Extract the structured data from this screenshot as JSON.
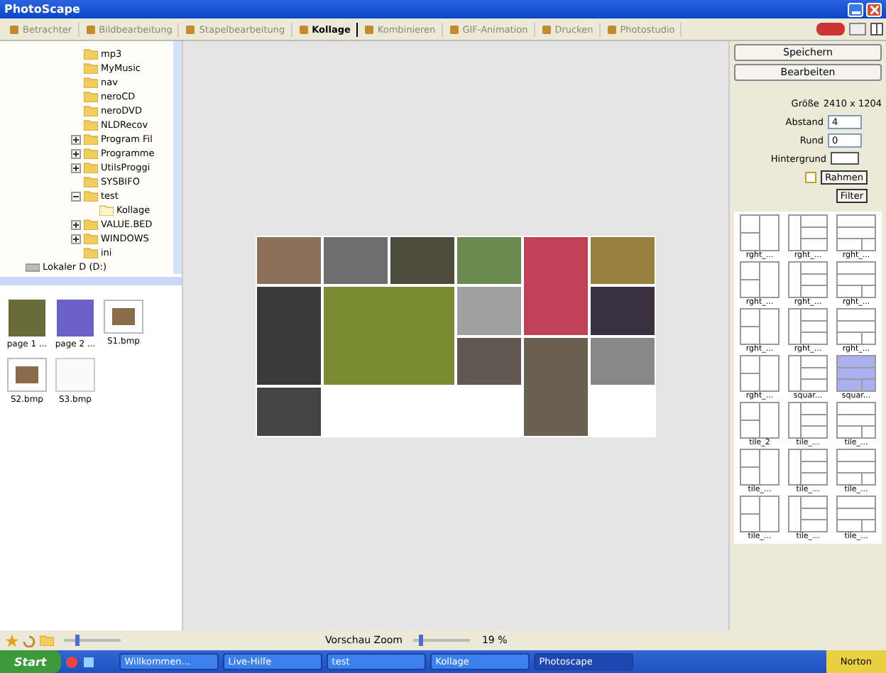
{
  "window": {
    "title": "PhotoScape"
  },
  "tabs": [
    {
      "label": "Betrachter",
      "selected": false
    },
    {
      "label": "Bildbearbeitung",
      "selected": false
    },
    {
      "label": "Stapelbearbeitung",
      "selected": false
    },
    {
      "label": "Kollage",
      "selected": true
    },
    {
      "label": "Kombinieren",
      "selected": false
    },
    {
      "label": "GIF-Animation",
      "selected": false
    },
    {
      "label": "Drucken",
      "selected": false
    },
    {
      "label": "Photostudio",
      "selected": false
    }
  ],
  "tree": {
    "folders": [
      {
        "label": "mp3",
        "expandable": false,
        "expanded": false
      },
      {
        "label": "MyMusic",
        "expandable": false,
        "expanded": false
      },
      {
        "label": "nav",
        "expandable": false,
        "expanded": false
      },
      {
        "label": "neroCD",
        "expandable": false,
        "expanded": false
      },
      {
        "label": "neroDVD",
        "expandable": false,
        "expanded": false
      },
      {
        "label": "NLDRecov",
        "expandable": false,
        "expanded": false
      },
      {
        "label": "Program Fil",
        "expandable": true,
        "expanded": false
      },
      {
        "label": "Programme",
        "expandable": true,
        "expanded": false
      },
      {
        "label": "UtilsProggi",
        "expandable": true,
        "expanded": false
      },
      {
        "label": "SYSBIFO",
        "expandable": false,
        "expanded": false
      },
      {
        "label": "test",
        "expandable": true,
        "expanded": true,
        "children": [
          {
            "label": "Kollage"
          }
        ]
      },
      {
        "label": "VALUE.BED",
        "expandable": true,
        "expanded": false
      },
      {
        "label": "WINDOWS",
        "expandable": true,
        "expanded": false
      },
      {
        "label": "ini",
        "expandable": false,
        "expanded": false
      }
    ],
    "drives": [
      {
        "label": "Lokaler D (D:)"
      }
    ]
  },
  "thumbnails": [
    {
      "label": "page 1 ...",
      "kind": "photo"
    },
    {
      "label": "page 2 ...",
      "kind": "photo"
    },
    {
      "label": "S1.bmp",
      "kind": "layout"
    },
    {
      "label": "S2.bmp",
      "kind": "layout"
    },
    {
      "label": "S3.bmp",
      "kind": "blank"
    }
  ],
  "panel": {
    "buttons": [
      "Speichern",
      "Bearbeiten"
    ],
    "size_label": "Größe",
    "size_value": "2410 x 1204",
    "spacing_label": "Abstand",
    "spacing_value": "4",
    "round_label": "Rund",
    "round_value": "0",
    "background_label": "Hintergrund",
    "frame": {
      "label": "Rahmen",
      "checked": false
    },
    "filter_button": "Filter"
  },
  "templates": [
    {
      "label": "rght_...",
      "selected": false
    },
    {
      "label": "rght_...",
      "selected": false
    },
    {
      "label": "rght_...",
      "selected": false
    },
    {
      "label": "rght_...",
      "selected": false
    },
    {
      "label": "rght_...",
      "selected": false
    },
    {
      "label": "rght_...",
      "selected": false
    },
    {
      "label": "rght_...",
      "selected": false
    },
    {
      "label": "rght_...",
      "selected": false
    },
    {
      "label": "rght_...",
      "selected": false
    },
    {
      "label": "rght_...",
      "selected": false
    },
    {
      "label": "squar...",
      "selected": false
    },
    {
      "label": "squar...",
      "selected": true
    },
    {
      "label": "tile_2",
      "selected": false
    },
    {
      "label": "tile_...",
      "selected": false
    },
    {
      "label": "tile_...",
      "selected": false
    },
    {
      "label": "tile_...",
      "selected": false
    },
    {
      "label": "tile_...",
      "selected": false
    },
    {
      "label": "tile_...",
      "selected": false
    },
    {
      "label": "tile_...",
      "selected": false
    },
    {
      "label": "tile_...",
      "selected": false
    },
    {
      "label": "tile_...",
      "selected": false
    }
  ],
  "status_bar": {
    "thumb_zoom": {
      "level": 0.2
    },
    "zoom_label": "Vorschau Zoom",
    "zoom": {
      "level": 0.1
    },
    "zoom_value": "19 %"
  },
  "taskbar": {
    "start": "Start",
    "tasks": [
      {
        "label": "Willkommen...",
        "selected": false
      },
      {
        "label": "Live-Hilfe",
        "selected": false
      },
      {
        "label": "test",
        "selected": false
      },
      {
        "label": "Kollage",
        "selected": false
      },
      {
        "label": "Photoscape",
        "selected": true
      }
    ],
    "tray": "Norton"
  }
}
